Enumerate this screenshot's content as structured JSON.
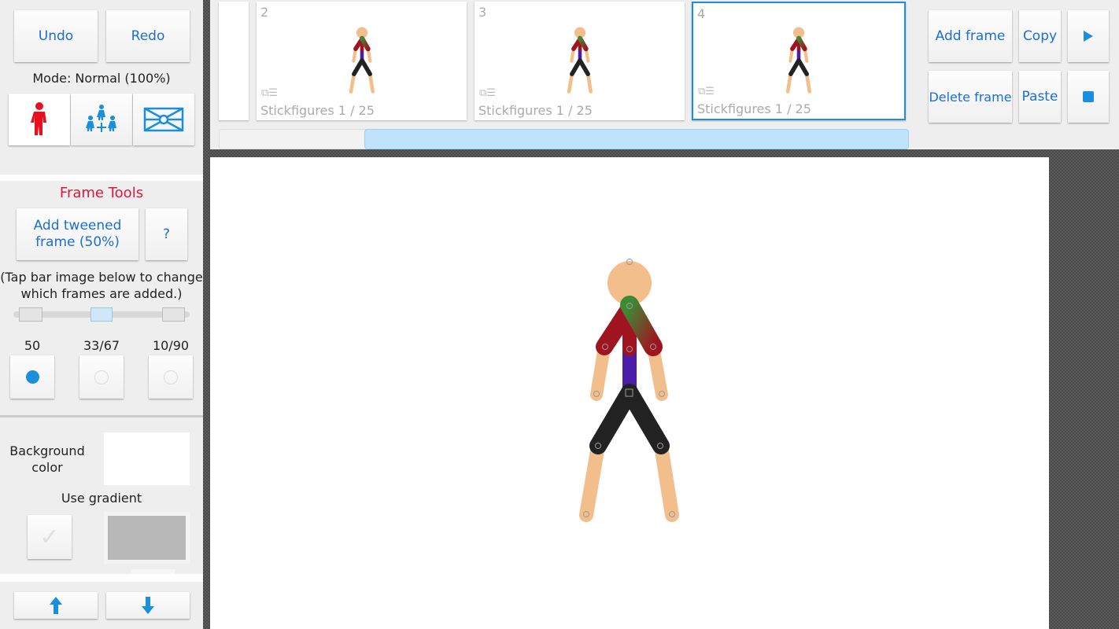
{
  "toolbar": {
    "undo": "Undo",
    "redo": "Redo",
    "mode": "Mode: Normal (100%)"
  },
  "mode_buttons": [
    {
      "icon": "single-figure-icon",
      "color": "#e8101e"
    },
    {
      "icon": "move-all-figures-icon",
      "color": "#1a8fe0"
    },
    {
      "icon": "move-background-icon",
      "color": "#1a8fe0"
    }
  ],
  "frame_tools": {
    "title": "Frame Tools",
    "title_color": "#e0163c",
    "add_tweened": "Add tweened frame (50%)",
    "help": "?",
    "hint": "(Tap bar image below to change which frames are added.)",
    "options": [
      {
        "label": "50",
        "selected": true
      },
      {
        "label": "33/67",
        "selected": false
      },
      {
        "label": "10/90",
        "selected": false
      }
    ]
  },
  "background": {
    "label": "Background color",
    "color": "#ffffff",
    "use_gradient": "Use gradient",
    "gradient_checked": false,
    "gradient_color": "#b8b8b8"
  },
  "frames": [
    {
      "number": "2",
      "caption": "Stickfigures 1 / 25",
      "selected": false
    },
    {
      "number": "3",
      "caption": "Stickfigures 1 / 25",
      "selected": false
    },
    {
      "number": "4",
      "caption": "Stickfigures 1 / 25",
      "selected": true
    }
  ],
  "frame_actions": {
    "add": "Add frame",
    "copy": "Copy",
    "delete": "Delete frame",
    "paste": "Paste",
    "play_icon": "play-icon",
    "stop_icon": "stop-icon"
  },
  "accent": "#1a8fe0"
}
